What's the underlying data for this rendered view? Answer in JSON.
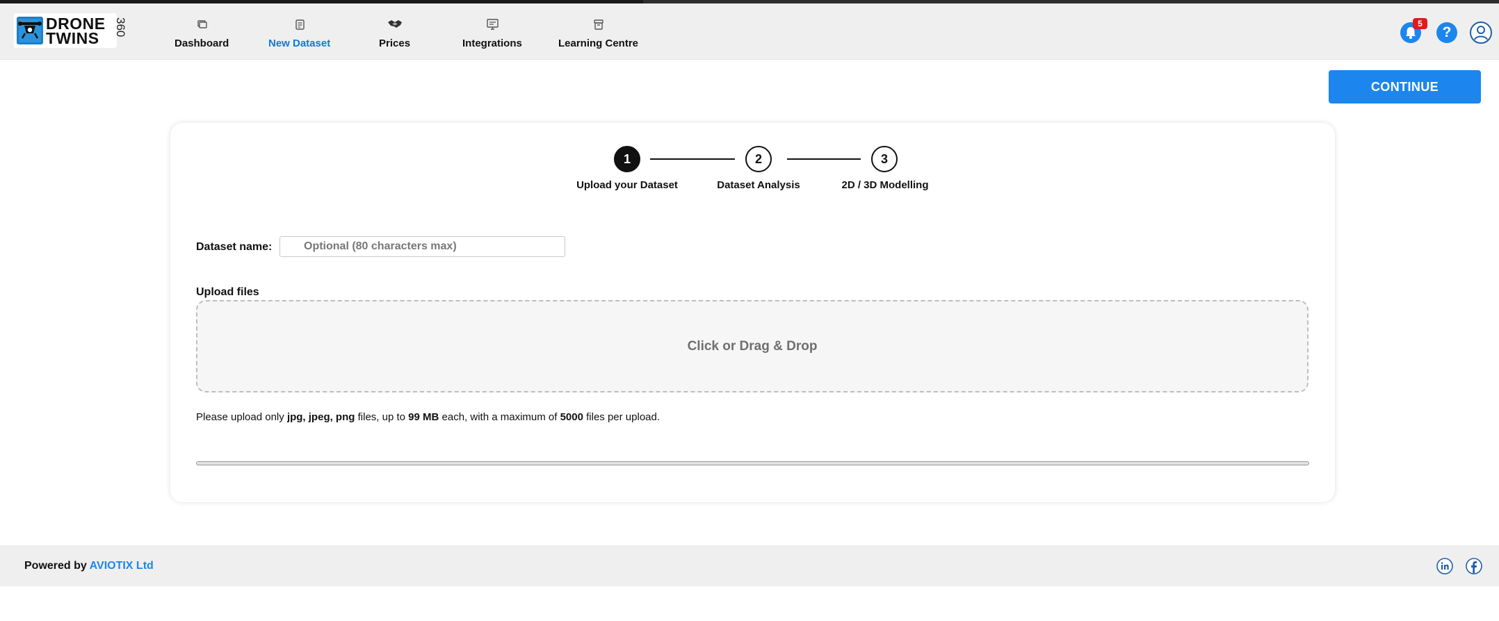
{
  "brand": {
    "name_line1": "DRONE",
    "name_line2": "TWINS",
    "suffix": "360"
  },
  "nav": {
    "items": [
      {
        "label": "Dashboard",
        "icon": "dashboard-icon",
        "active": false
      },
      {
        "label": "New Dataset",
        "icon": "new-dataset-icon",
        "active": true
      },
      {
        "label": "Prices",
        "icon": "handshake-icon",
        "active": false
      },
      {
        "label": "Integrations",
        "icon": "monitor-icon",
        "active": false
      },
      {
        "label": "Learning Centre",
        "icon": "archive-icon",
        "active": false
      }
    ]
  },
  "header_actions": {
    "notifications_count": "5",
    "help_label": "?",
    "accent_color": "#1c86ee",
    "badge_color": "#e01b1b"
  },
  "toolbar": {
    "continue_label": "CONTINUE"
  },
  "stepper": {
    "steps": [
      {
        "number": "1",
        "label": "Upload your Dataset",
        "active": true
      },
      {
        "number": "2",
        "label": "Dataset Analysis",
        "active": false
      },
      {
        "number": "3",
        "label": "2D / 3D Modelling",
        "active": false
      }
    ]
  },
  "form": {
    "dataset_name_label": "Dataset name:",
    "dataset_name_placeholder": "Optional (80 characters max)",
    "dataset_name_value": "",
    "upload_label": "Upload files",
    "dropzone_text": "Click or Drag & Drop",
    "note": {
      "prefix": "Please upload only ",
      "formats": "jpg, jpeg, png",
      "mid1": " files, up to ",
      "size": "99 MB",
      "mid2": " each, with a maximum of ",
      "max_files": "5000",
      "suffix": " files per upload."
    },
    "upload_progress": 0
  },
  "footer": {
    "powered_prefix": "Powered by ",
    "company": "AVIOTIX Ltd",
    "social": [
      "linkedin-icon",
      "facebook-icon"
    ]
  }
}
